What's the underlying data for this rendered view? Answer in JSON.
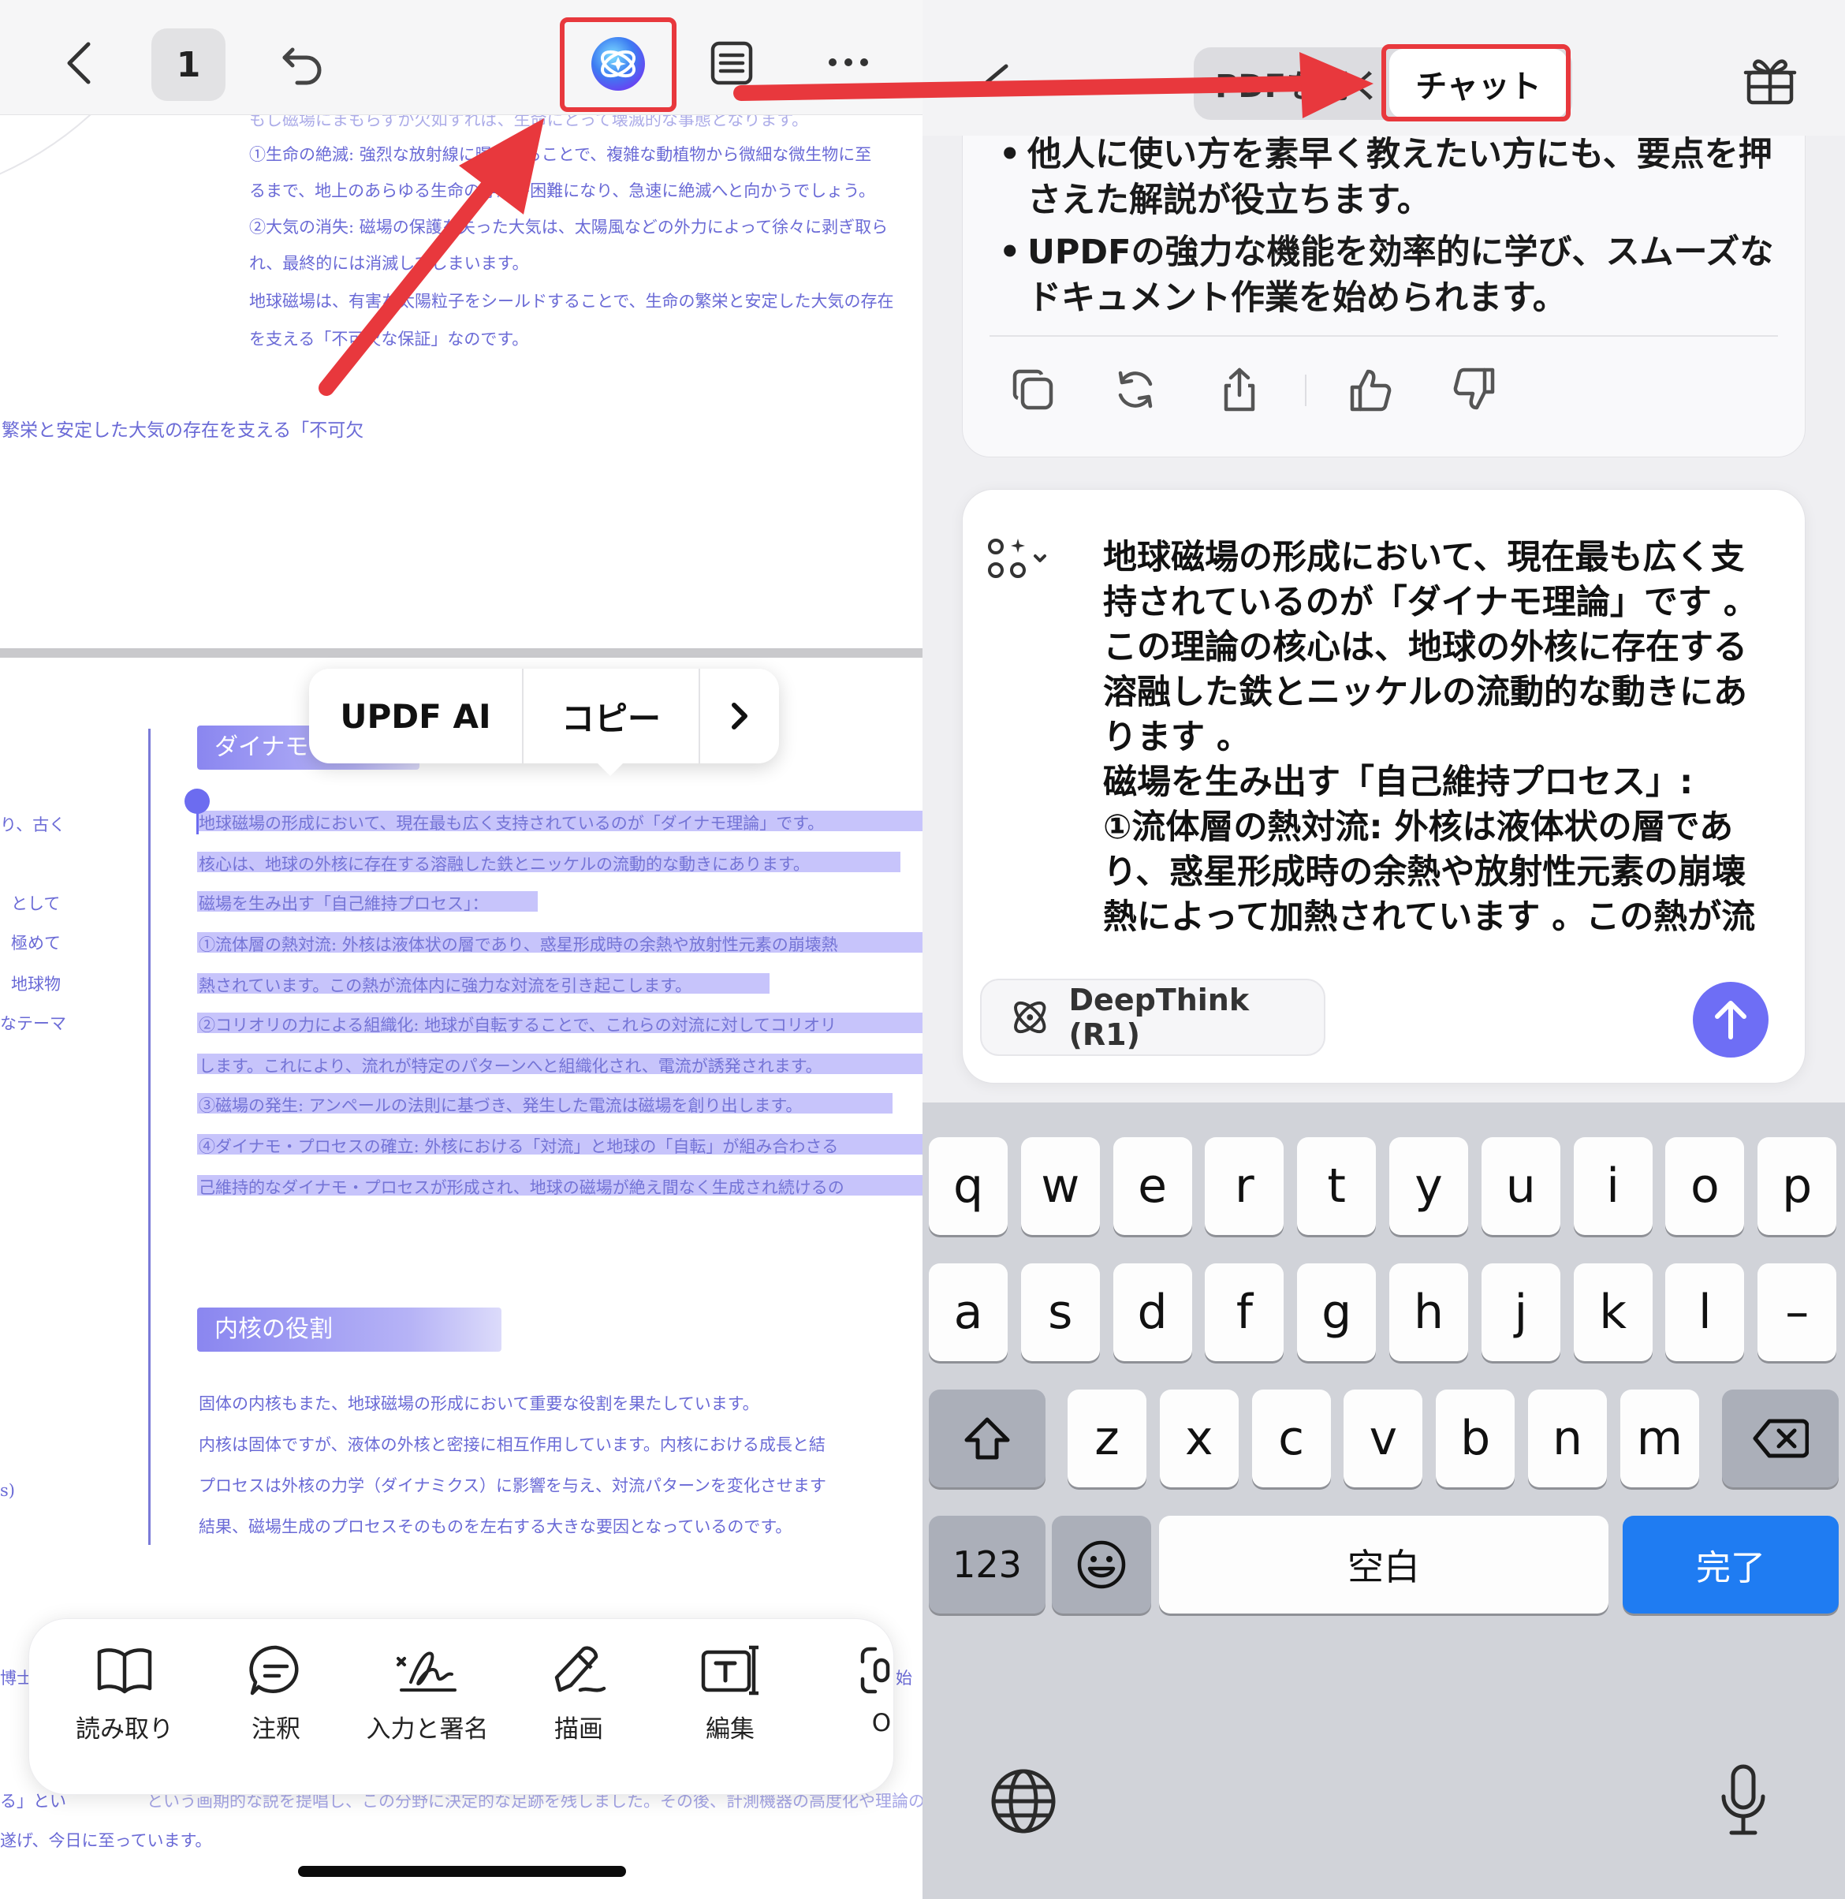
{
  "left": {
    "page_number": "1",
    "pdf_text_top": [
      "もし磁場にまもらずが欠如すれば、生命にとって壊滅的な事態となります。",
      "①生命の絶滅: 強烈な放射線に曝されることで、複雑な動植物から微細な微生物に至",
      "るまで、地上のあらゆる生命の存続が困難になり、急速に絶滅へと向かうでしょう。",
      "②大気の消失: 磁場の保護を失った大気は、太陽風などの外力によって徐々に剥ぎ取ら",
      "れ、最終的には消滅してしまいます。",
      "地球磁場は、有害な太陽粒子をシールドすることで、生命の繁栄と安定した大気の存在",
      "を支える「不可欠な保証」なのです。"
    ],
    "pdf_text_left_fragment": "繁栄と安定した大気の存在を支える「不可欠",
    "section_dynamo_title": "ダイナモ",
    "left_margin_fragments": [
      "り、古く",
      "として",
      "極めて",
      "地球物",
      "なテーマ",
      "s)",
      "博士",
      "る」とい",
      "遂げ、今日に至っています。"
    ],
    "selected_lines": [
      "地球磁場の形成において、現在最も広く支持されているのが「ダイナモ理論」です。",
      "核心は、地球の外核に存在する溶融した鉄とニッケルの流動的な動きにあります。",
      "磁場を生み出す「自己維持プロセス」：",
      "①流体層の熱対流: 外核は液体状の層であり、惑星形成時の余熱や放射性元素の崩壊熱",
      "熱されています。この熱が流体内に強力な対流を引き起こします。",
      "②コリオリの力による組織化: 地球が自転することで、これらの対流に対してコリオリ",
      "します。これにより、流れが特定のパターンへと組織化され、電流が誘発されます。",
      "③磁場の発生: アンペールの法則に基づき、発生した電流は磁場を創り出します。",
      "④ダイナモ・プロセスの確立: 外核における「対流」と地球の「自転」が組み合わさる",
      "己維持的なダイナモ・プロセスが形成され、地球の磁場が絶え間なく生成され続けるの"
    ],
    "section_inner_core_title": "内核の役割",
    "inner_core_lines": [
      "固体の内核もまた、地球磁場の形成において重要な役割を果たしています。",
      "内核は固体ですが、液体の外核と密接に相互作用しています。内核における成長と結",
      "プロセスは外核の力学（ダイナミクス）に影響を与え、対流パターンを変化させます",
      "結果、磁場生成のプロセスそのものを左右する大きな要因となっているのです。"
    ],
    "bottom_fragment_line": "という画期的な説を提唱し、この分野に決定的な足跡を残しました。その後、計測機器の高度化や理論の",
    "bottom_fragment_right": "始",
    "context_menu": {
      "ai_label": "UPDF AI",
      "copy_label": "コピー"
    },
    "toolbar": [
      {
        "label": "読み取り",
        "icon": "book-icon"
      },
      {
        "label": "注釈",
        "icon": "comment-icon"
      },
      {
        "label": "入力と署名",
        "icon": "signature-icon"
      },
      {
        "label": "描画",
        "icon": "pen-icon"
      },
      {
        "label": "編集",
        "icon": "text-edit-icon"
      },
      {
        "label": "O",
        "icon": "ocr-icon"
      }
    ]
  },
  "right": {
    "tab_inactive": "PDFを開く",
    "tab_active": "チャット",
    "bullets": [
      "他人に使い方を素早く教えたい方にも、要点を押さえた解説が役立ちます。",
      "UPDFの強力な機能を効率的に学び、スムーズなドキュメント作業を始められます。"
    ],
    "input_text_lines": [
      "地球磁場の形成において、現在最も広く支",
      "持されているのが「ダイナモ理論」です 。",
      "この理論の核心は、地球の外核に存在する",
      "溶融した鉄とニッケルの流動的な動きにあ",
      "ります 。",
      "磁場を生み出す「自己維持プロセス」:",
      "①流体層の熱対流: 外核は液体状の層であ",
      "り、惑星形成時の余熱や放射性元素の崩壊",
      "熱によって加熱されています 。この熱が流"
    ],
    "deepthink_label": "DeepThink (R1)",
    "keyboard": {
      "row1": [
        "q",
        "w",
        "e",
        "r",
        "t",
        "y",
        "u",
        "i",
        "o",
        "p"
      ],
      "row2": [
        "a",
        "s",
        "d",
        "f",
        "g",
        "h",
        "j",
        "k",
        "l",
        "–"
      ],
      "row3": [
        "z",
        "x",
        "c",
        "v",
        "b",
        "n",
        "m"
      ],
      "numbers_key": "123",
      "space_key": "空白",
      "done_key": "完了"
    }
  },
  "colors": {
    "annotation_red": "#e8383d",
    "accent_blue": "#1f7cf2",
    "send_purple": "#6e6ef5",
    "pdf_text_purple": "#6a6ad6",
    "selection_lilac": "#c7c4fb"
  }
}
